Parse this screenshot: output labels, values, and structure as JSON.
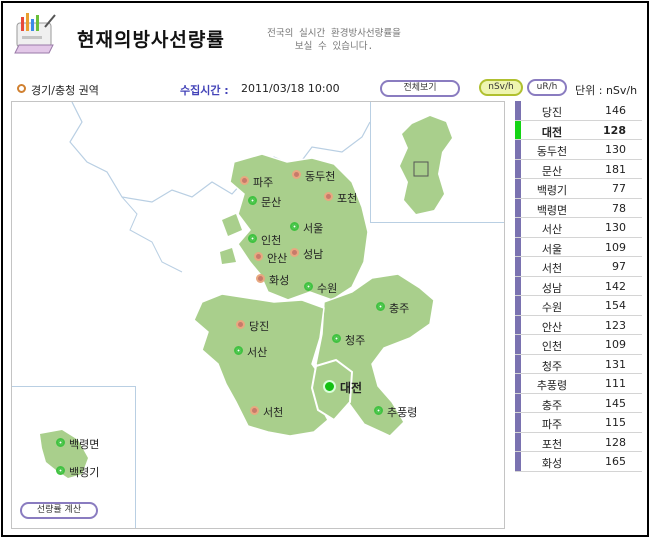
{
  "header": {
    "title": "현재의방사선량률",
    "subtitle_lines": [
      "전국의 실시간 환경방사선량률을",
      "보실 수 있습니다."
    ]
  },
  "toolbar": {
    "region": "경기/충청 권역",
    "collect_label": "수집시간 :",
    "collect_time": "2011/03/18 10:00",
    "view_all": "전체보기",
    "unit_nsv": "nSv/h",
    "unit_urh": "uR/h",
    "unit_label": "단위 : nSv/h"
  },
  "map": {
    "calc_button": "선량률 계산",
    "sites": [
      {
        "name": "파주",
        "type": "orange"
      },
      {
        "name": "동두천",
        "type": "orange"
      },
      {
        "name": "문산",
        "type": "green"
      },
      {
        "name": "포천",
        "type": "orange"
      },
      {
        "name": "서울",
        "type": "green"
      },
      {
        "name": "인천",
        "type": "green"
      },
      {
        "name": "성남",
        "type": "orange"
      },
      {
        "name": "안산",
        "type": "orange"
      },
      {
        "name": "화성",
        "type": "orange"
      },
      {
        "name": "수원",
        "type": "green"
      },
      {
        "name": "충주",
        "type": "green"
      },
      {
        "name": "당진",
        "type": "orange"
      },
      {
        "name": "청주",
        "type": "green"
      },
      {
        "name": "서산",
        "type": "green"
      },
      {
        "name": "대전",
        "type": "selected"
      },
      {
        "name": "서천",
        "type": "orange"
      },
      {
        "name": "추풍령",
        "type": "green"
      },
      {
        "name": "백령면",
        "type": "green"
      },
      {
        "name": "백령기",
        "type": "green"
      }
    ]
  },
  "list": [
    {
      "name": "당진",
      "value": "146"
    },
    {
      "name": "대전",
      "value": "128",
      "selected": true
    },
    {
      "name": "동두천",
      "value": "130"
    },
    {
      "name": "문산",
      "value": "181"
    },
    {
      "name": "백령기",
      "value": "77"
    },
    {
      "name": "백령면",
      "value": "78"
    },
    {
      "name": "서산",
      "value": "130"
    },
    {
      "name": "서울",
      "value": "109"
    },
    {
      "name": "서천",
      "value": "97"
    },
    {
      "name": "성남",
      "value": "142"
    },
    {
      "name": "수원",
      "value": "154"
    },
    {
      "name": "안산",
      "value": "123"
    },
    {
      "name": "인천",
      "value": "109"
    },
    {
      "name": "청주",
      "value": "131"
    },
    {
      "name": "추풍령",
      "value": "111"
    },
    {
      "name": "충주",
      "value": "145"
    },
    {
      "name": "파주",
      "value": "115"
    },
    {
      "name": "포천",
      "value": "128"
    },
    {
      "name": "화성",
      "value": "165"
    }
  ],
  "colors": {
    "land": "#a9cf8c",
    "sea_line": "#b9cfe3",
    "stripe": "#7a72b0",
    "stripe_active": "#14d414"
  }
}
